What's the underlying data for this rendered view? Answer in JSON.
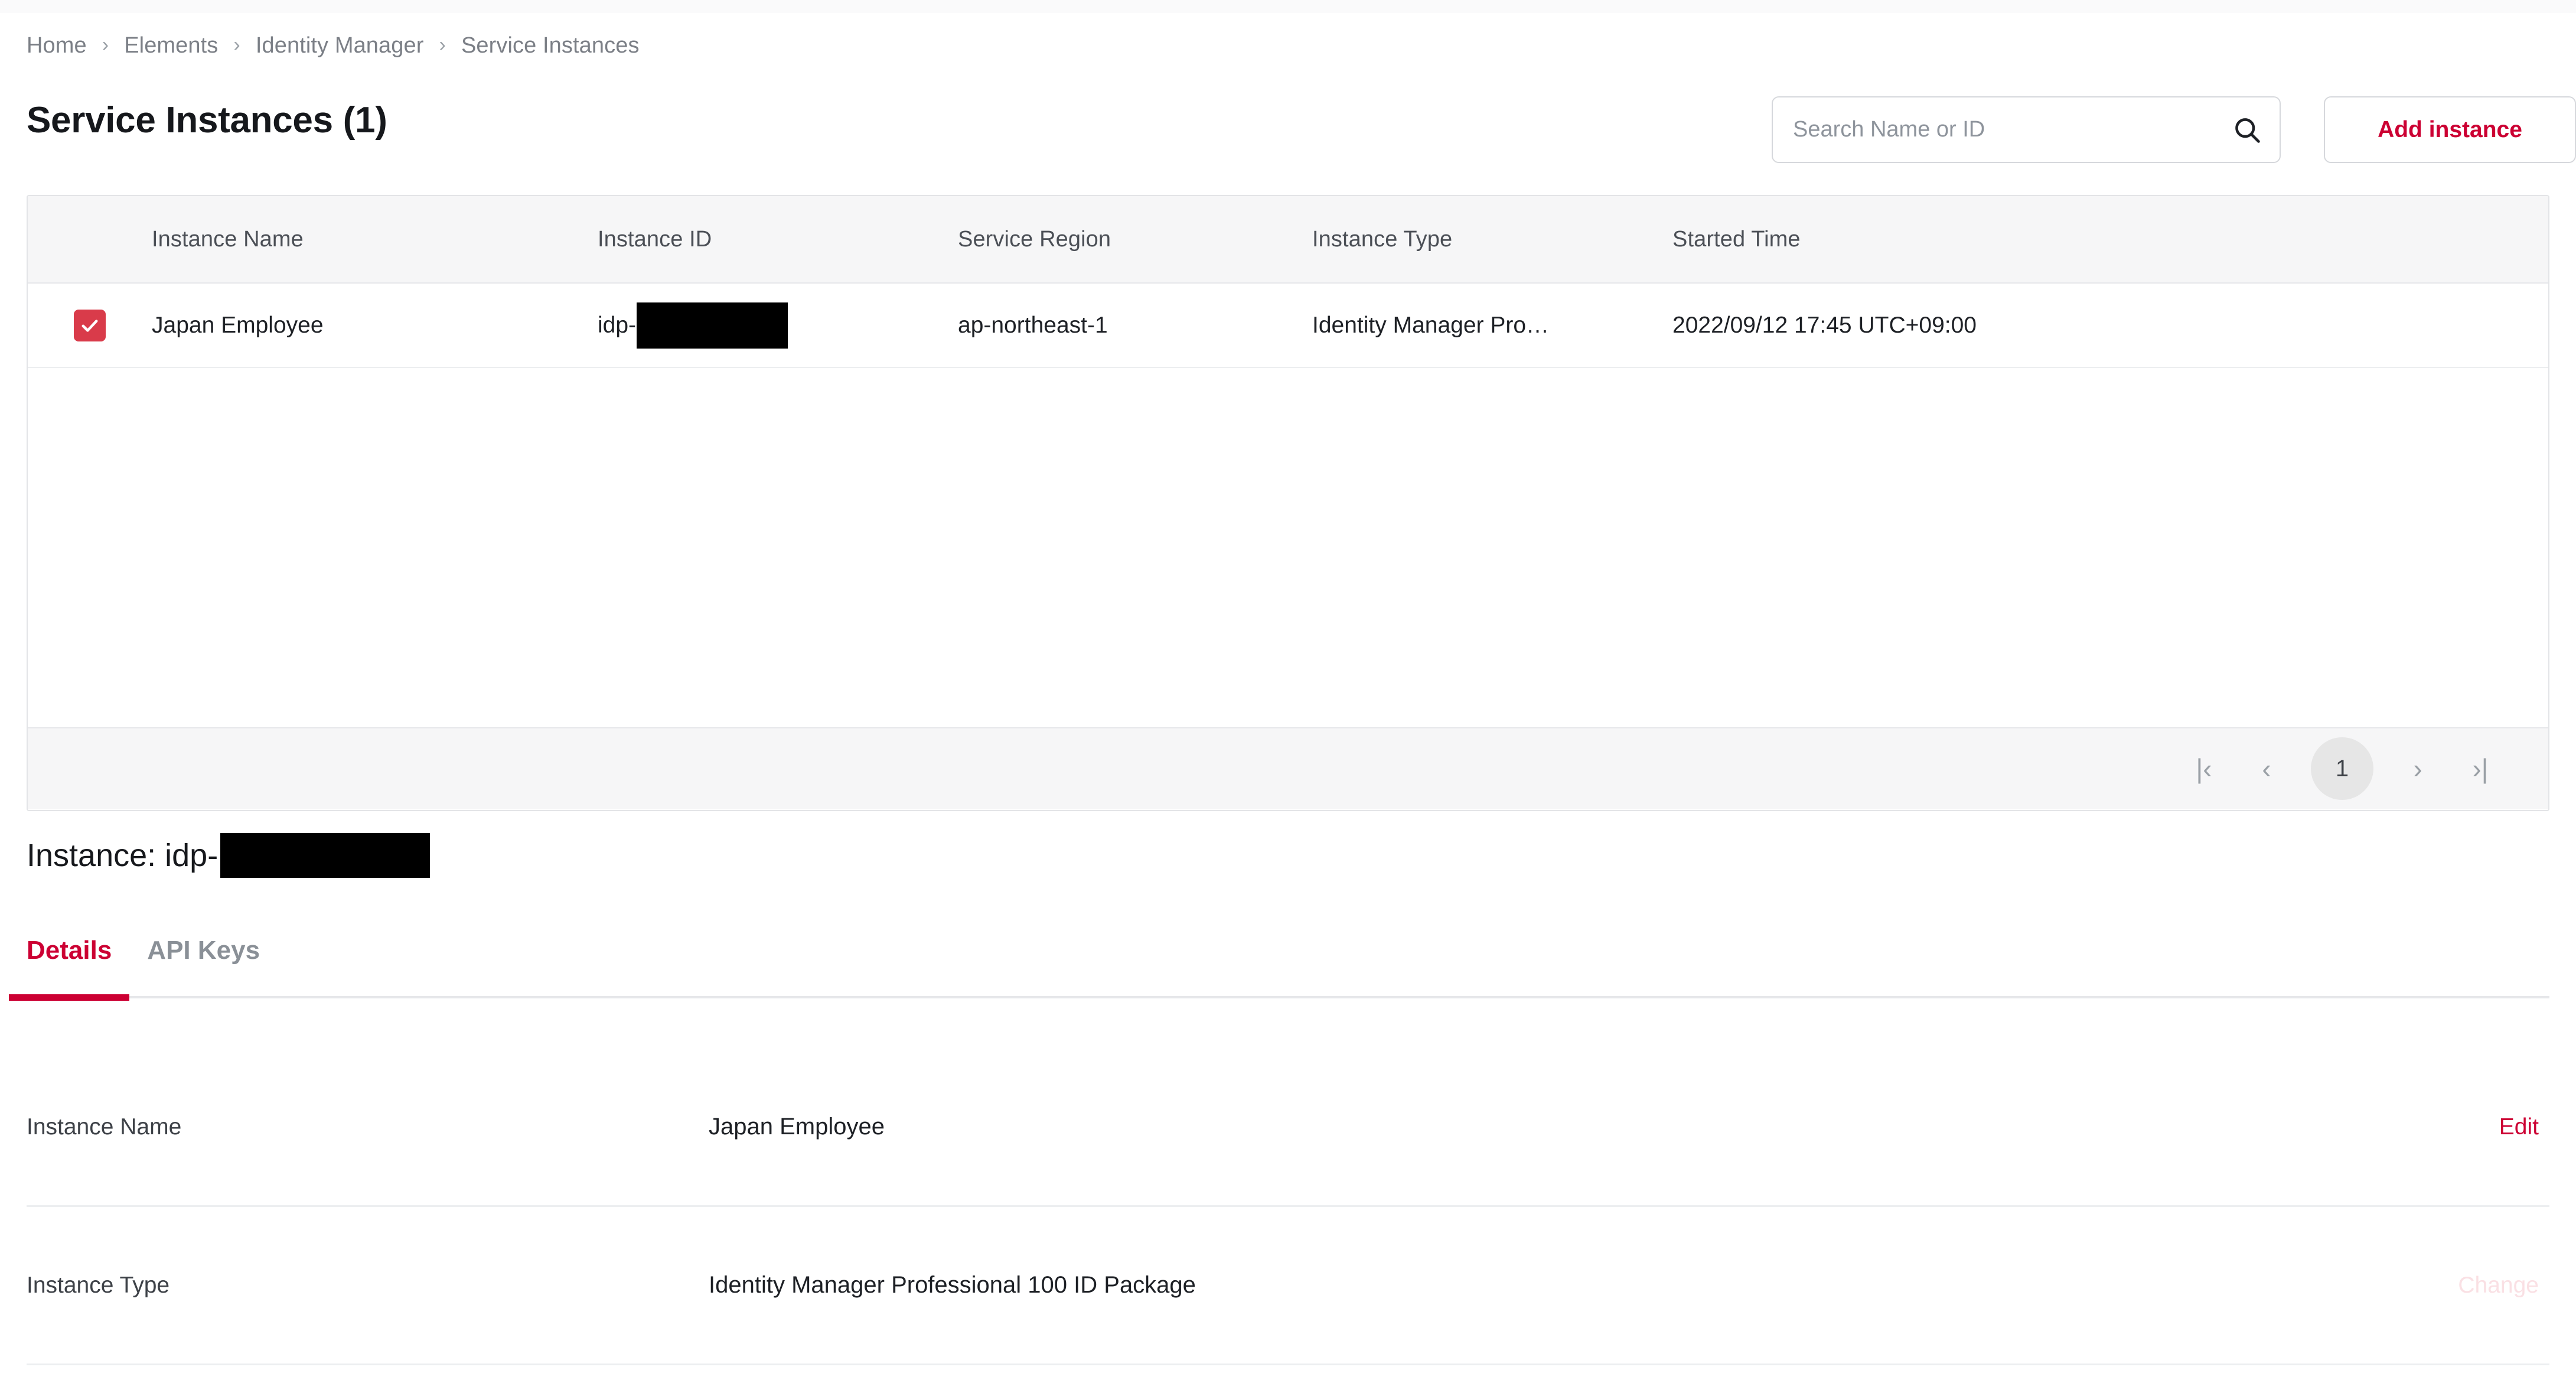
{
  "breadcrumb": {
    "items": [
      {
        "label": "Home"
      },
      {
        "label": "Elements"
      },
      {
        "label": "Identity Manager"
      },
      {
        "label": "Service Instances"
      }
    ],
    "separator": "›"
  },
  "header": {
    "title": "Service Instances (1)",
    "search": {
      "placeholder": "Search Name or ID",
      "value": "",
      "icon": "search-icon"
    },
    "add_button": {
      "label": "Add instance"
    }
  },
  "table": {
    "columns": [
      {
        "key": "select",
        "label": ""
      },
      {
        "key": "name",
        "label": "Instance Name"
      },
      {
        "key": "id",
        "label": "Instance ID"
      },
      {
        "key": "region",
        "label": "Service Region"
      },
      {
        "key": "type",
        "label": "Instance Type"
      },
      {
        "key": "time",
        "label": "Started Time"
      }
    ],
    "rows": [
      {
        "selected": true,
        "name": "Japan Employee",
        "id_prefix": "idp-",
        "id_redacted": true,
        "region": "ap-northeast-1",
        "type": "Identity Manager Pro…",
        "time": "2022/09/12 17:45 UTC+09:00"
      }
    ],
    "pagination": {
      "first": "|‹",
      "prev": "‹",
      "current_page": "1",
      "next": "›",
      "last": "›|"
    }
  },
  "instance": {
    "heading_prefix": "Instance: idp-",
    "heading_redacted": true,
    "tabs": [
      {
        "label": "Details",
        "active": true
      },
      {
        "label": "API Keys",
        "active": false
      }
    ],
    "details": [
      {
        "label": "Instance Name",
        "value": "Japan Employee",
        "action": "Edit",
        "action_disabled": false
      },
      {
        "label": "Instance Type",
        "value": "Identity Manager Professional 100 ID Package",
        "action": "Change",
        "action_disabled": true
      }
    ]
  },
  "colors": {
    "accent_red": "#cc0033",
    "checkbox_red": "#d93b4a",
    "header_bg": "#f6f6f7",
    "border": "#e3e4e7",
    "muted_text": "#7b7f86",
    "disabled_action": "#fae0e4"
  }
}
